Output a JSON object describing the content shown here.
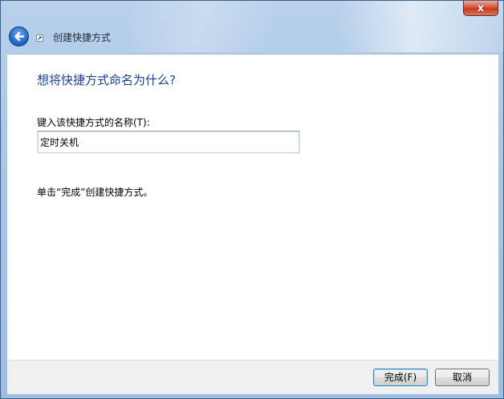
{
  "window": {
    "title": "创建快捷方式",
    "close_label": "x"
  },
  "page": {
    "heading": "想将快捷方式命名为什么?",
    "field_label": "键入该快捷方式的名称(T):",
    "name_value": "定时关机",
    "hint": "单击“完成”创建快捷方式。"
  },
  "buttons": {
    "finish": "完成(F)",
    "cancel": "取消"
  },
  "icons": {
    "back": "back-arrow-icon",
    "shortcut": "shortcut-icon",
    "close": "close-icon"
  }
}
